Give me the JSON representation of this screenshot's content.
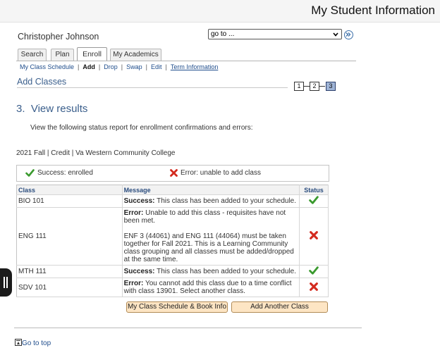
{
  "banner": {
    "title": "My Student Information"
  },
  "student": {
    "name": "Christopher Johnson"
  },
  "goto": {
    "selected": "go to ..."
  },
  "tabs": [
    {
      "label": "Search",
      "active": false
    },
    {
      "label": "Plan",
      "active": false
    },
    {
      "label": "Enroll",
      "active": true
    },
    {
      "label": "My Academics",
      "active": false
    }
  ],
  "subnav": {
    "schedule": "My Class Schedule",
    "add": "Add",
    "drop": "Drop",
    "swap": "Swap",
    "edit": "Edit",
    "term_info": "Term Information"
  },
  "page": {
    "title": "Add Classes"
  },
  "steps": [
    {
      "label": "1",
      "current": false
    },
    {
      "label": "2",
      "current": false
    },
    {
      "label": "3",
      "current": true
    }
  ],
  "section": {
    "heading": "3.  View results",
    "instructions": "View the following status report for enrollment confirmations and errors:"
  },
  "term": {
    "line": "2021 Fall | Credit | Va Western Community College"
  },
  "legend": {
    "success": "Success: enrolled",
    "error": "Error: unable to add class"
  },
  "table": {
    "headers": {
      "class": "Class",
      "message": "Message",
      "status": "Status"
    },
    "rows": [
      {
        "class": "BIO  101",
        "lead": "Success:",
        "text": " This class has been added to your schedule.",
        "status": "success"
      },
      {
        "class": "ENG  111",
        "lead": "Error:",
        "text": " Unable to add this class - requisites have not been met.",
        "extra": "ENF 3 (44061) and ENG 111 (44064) must be taken together for Fall 2021. This is a Learning Community class grouping and all classes must be added/dropped at the same time.",
        "status": "error"
      },
      {
        "class": "MTH  111",
        "lead": "Success:",
        "text": " This class has been added to your schedule.",
        "status": "success"
      },
      {
        "class": "SDV  101",
        "lead": "Error:",
        "text": " You cannot add this class due to a time conflict with class 13901. Select another class.",
        "status": "error"
      }
    ]
  },
  "buttons": {
    "schedule_book": "My Class Schedule & Book Info",
    "add_another": "Add Another Class"
  },
  "footer": {
    "go_to_top": "Go to top"
  },
  "colors": {
    "accent": "#3b5f8c",
    "link": "#1f4d8c",
    "success": "#3a9a2e",
    "error": "#d32a1e",
    "button_bg": "#fde5c4"
  }
}
